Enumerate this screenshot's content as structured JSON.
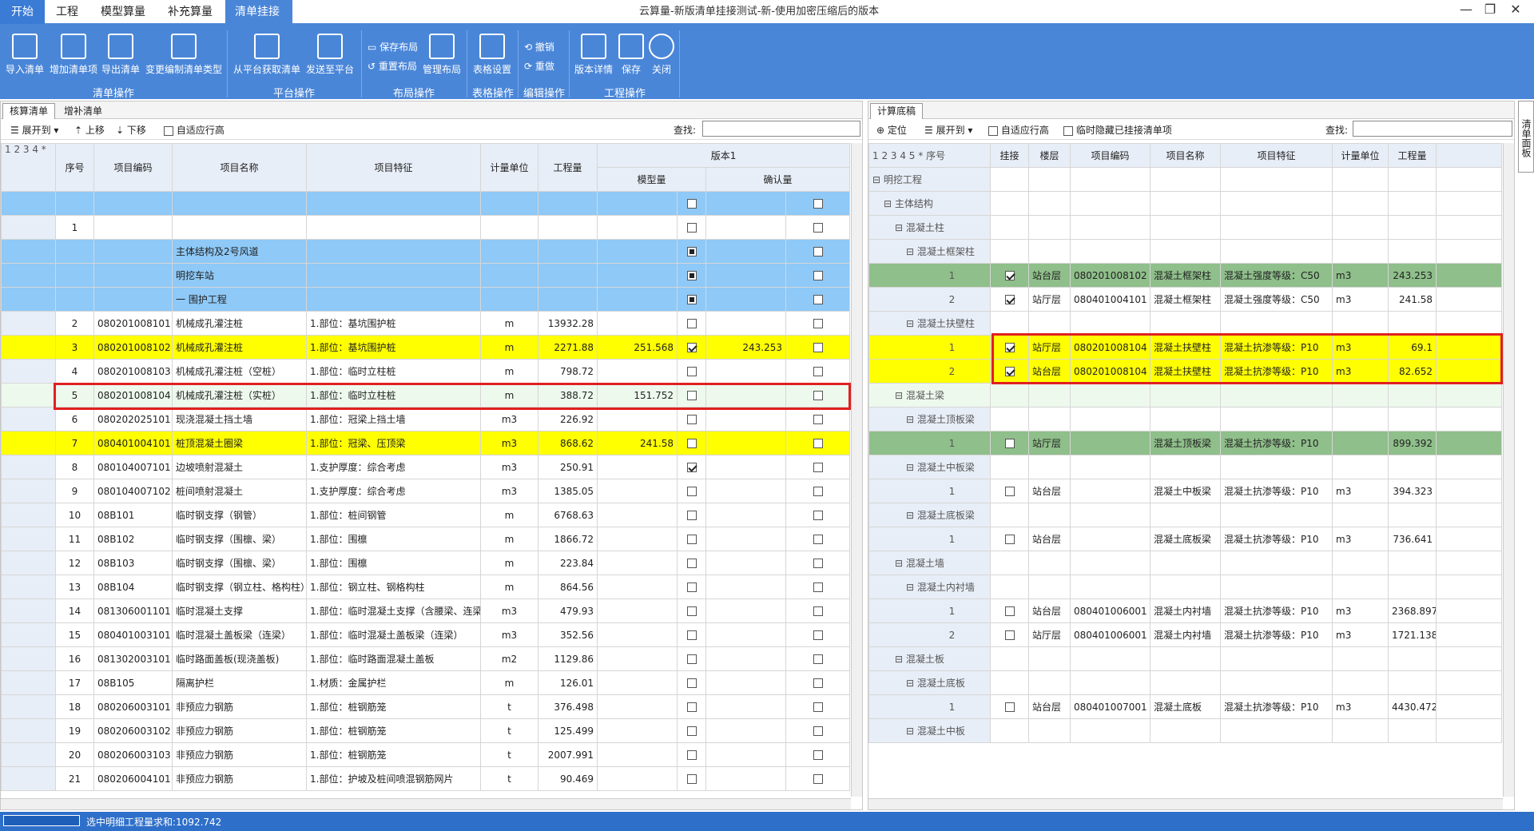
{
  "menu_tabs": [
    "开始",
    "工程",
    "模型算量",
    "补充算量",
    "清单挂接"
  ],
  "window_title": "云算量-新版清单挂接测试-新-使用加密压缩后的版本",
  "window_controls": [
    "—",
    "❐",
    "✕"
  ],
  "ribbon": {
    "buttons": [
      "导入清单",
      "增加清单项",
      "导出清单",
      "变更编制清单类型",
      "从平台获取清单",
      "发送至平台",
      "管理布局",
      "表格设置",
      "版本详情",
      "保存",
      "关闭"
    ],
    "small": [
      "保存布局",
      "重置布局",
      "撤销",
      "重做"
    ],
    "groups": [
      "清单操作",
      "平台操作",
      "布局操作",
      "表格操作",
      "编辑操作",
      "工程操作"
    ]
  },
  "left": {
    "tabs": [
      "核算清单",
      "增补清单"
    ],
    "toolbar": {
      "levels": "1 2 3 4 *",
      "expand": "展开到",
      "up": "上移",
      "down": "下移",
      "auto": "自适应行高",
      "search": "查找:"
    },
    "headers": {
      "seq": "序号",
      "code": "项目编码",
      "name": "项目名称",
      "feature": "项目特征",
      "unit": "计量单位",
      "qty": "工程量",
      "version": "版本1",
      "model": "模型量",
      "confirm": "确认量"
    },
    "rows": [
      {
        "seq": "",
        "code": "",
        "name": "",
        "feature": "",
        "unit": "",
        "qty": "",
        "model": "",
        "mc": "off",
        "confirm": "",
        "cc": "off",
        "style": "blue"
      },
      {
        "seq": "1",
        "code": "",
        "name": "",
        "feature": "",
        "unit": "",
        "qty": "",
        "model": "",
        "mc": "off",
        "confirm": "",
        "cc": "off",
        "style": ""
      },
      {
        "seq": "",
        "code": "",
        "name": "主体结构及2号风道",
        "feature": "",
        "unit": "",
        "qty": "",
        "model": "",
        "mc": "sq",
        "confirm": "",
        "cc": "off",
        "style": "blue"
      },
      {
        "seq": "",
        "code": "",
        "name": "明挖车站",
        "feature": "",
        "unit": "",
        "qty": "",
        "model": "",
        "mc": "sq",
        "confirm": "",
        "cc": "off",
        "style": "blue"
      },
      {
        "seq": "",
        "code": "",
        "name": "一 围护工程",
        "feature": "",
        "unit": "",
        "qty": "",
        "model": "",
        "mc": "sq",
        "confirm": "",
        "cc": "off",
        "style": "blue"
      },
      {
        "seq": "2",
        "code": "080201008101",
        "name": "机械成孔灌注桩",
        "feature": "1.部位：基坑围护桩",
        "unit": "m",
        "qty": "13932.28",
        "model": "",
        "mc": "off",
        "confirm": "",
        "cc": "off",
        "style": ""
      },
      {
        "seq": "3",
        "code": "080201008102",
        "name": "机械成孔灌注桩",
        "feature": "1.部位：基坑围护桩",
        "unit": "m",
        "qty": "2271.88",
        "model": "251.568",
        "mc": "on",
        "confirm": "243.253",
        "cc": "off",
        "style": "yellow"
      },
      {
        "seq": "4",
        "code": "080201008103",
        "name": "机械成孔灌注桩（空桩）",
        "feature": "1.部位：临时立柱桩",
        "unit": "m",
        "qty": "798.72",
        "model": "",
        "mc": "off",
        "confirm": "",
        "cc": "off",
        "style": ""
      },
      {
        "seq": "5",
        "code": "080201008104",
        "name": "机械成孔灌注桩（实桩）",
        "feature": "1.部位：临时立柱桩",
        "unit": "m",
        "qty": "388.72",
        "model": "151.752",
        "mc": "off",
        "confirm": "",
        "cc": "off",
        "style": "lgreen"
      },
      {
        "seq": "6",
        "code": "080202025101",
        "name": "现浇混凝土挡土墙",
        "feature": "1.部位：冠梁上挡土墙",
        "unit": "m3",
        "qty": "226.92",
        "model": "",
        "mc": "off",
        "confirm": "",
        "cc": "off",
        "style": ""
      },
      {
        "seq": "7",
        "code": "080401004101",
        "name": "桩顶混凝土圈梁",
        "feature": "1.部位：冠梁、压顶梁",
        "unit": "m3",
        "qty": "868.62",
        "model": "241.58",
        "mc": "off",
        "confirm": "",
        "cc": "off",
        "style": "yellow"
      },
      {
        "seq": "8",
        "code": "080104007101",
        "name": "边坡喷射混凝土",
        "feature": "1.支护厚度：综合考虑",
        "unit": "m3",
        "qty": "250.91",
        "model": "",
        "mc": "on",
        "confirm": "",
        "cc": "off",
        "style": ""
      },
      {
        "seq": "9",
        "code": "080104007102",
        "name": "桩间喷射混凝土",
        "feature": "1.支护厚度：综合考虑",
        "unit": "m3",
        "qty": "1385.05",
        "model": "",
        "mc": "off",
        "confirm": "",
        "cc": "off",
        "style": ""
      },
      {
        "seq": "10",
        "code": "08B101",
        "name": "临时钢支撑（钢管）",
        "feature": "1.部位：桩间钢管",
        "unit": "m",
        "qty": "6768.63",
        "model": "",
        "mc": "off",
        "confirm": "",
        "cc": "off",
        "style": ""
      },
      {
        "seq": "11",
        "code": "08B102",
        "name": "临时钢支撑（围檩、梁）",
        "feature": "1.部位：围檩",
        "unit": "m",
        "qty": "1866.72",
        "model": "",
        "mc": "off",
        "confirm": "",
        "cc": "off",
        "style": ""
      },
      {
        "seq": "12",
        "code": "08B103",
        "name": "临时钢支撑（围檩、梁）",
        "feature": "1.部位：围檩",
        "unit": "m",
        "qty": "223.84",
        "model": "",
        "mc": "off",
        "confirm": "",
        "cc": "off",
        "style": ""
      },
      {
        "seq": "13",
        "code": "08B104",
        "name": "临时钢支撑（钢立柱、格构柱）",
        "feature": "1.部位：钢立柱、钢格构柱",
        "unit": "m",
        "qty": "864.56",
        "model": "",
        "mc": "off",
        "confirm": "",
        "cc": "off",
        "style": ""
      },
      {
        "seq": "14",
        "code": "081306001101",
        "name": "临时混凝土支撑",
        "feature": "1.部位：临时混凝土支撑（含腰梁、连梁",
        "unit": "m3",
        "qty": "479.93",
        "model": "",
        "mc": "off",
        "confirm": "",
        "cc": "off",
        "style": ""
      },
      {
        "seq": "15",
        "code": "080401003101",
        "name": "临时混凝土盖板梁（连梁）",
        "feature": "1.部位：临时混凝土盖板梁（连梁）",
        "unit": "m3",
        "qty": "352.56",
        "model": "",
        "mc": "off",
        "confirm": "",
        "cc": "off",
        "style": ""
      },
      {
        "seq": "16",
        "code": "081302003101",
        "name": "临时路面盖板(现浇盖板)",
        "feature": "1.部位：临时路面混凝土盖板",
        "unit": "m2",
        "qty": "1129.86",
        "model": "",
        "mc": "off",
        "confirm": "",
        "cc": "off",
        "style": ""
      },
      {
        "seq": "17",
        "code": "08B105",
        "name": "隔离护栏",
        "feature": "1.材质：金属护栏",
        "unit": "m",
        "qty": "126.01",
        "model": "",
        "mc": "off",
        "confirm": "",
        "cc": "off",
        "style": ""
      },
      {
        "seq": "18",
        "code": "080206003101",
        "name": "非预应力钢筋",
        "feature": "1.部位：桩钢筋笼",
        "unit": "t",
        "qty": "376.498",
        "model": "",
        "mc": "off",
        "confirm": "",
        "cc": "off",
        "style": ""
      },
      {
        "seq": "19",
        "code": "080206003102",
        "name": "非预应力钢筋",
        "feature": "1.部位：桩钢筋笼",
        "unit": "t",
        "qty": "125.499",
        "model": "",
        "mc": "off",
        "confirm": "",
        "cc": "off",
        "style": ""
      },
      {
        "seq": "20",
        "code": "080206003103",
        "name": "非预应力钢筋",
        "feature": "1.部位：桩钢筋笼",
        "unit": "t",
        "qty": "2007.991",
        "model": "",
        "mc": "off",
        "confirm": "",
        "cc": "off",
        "style": ""
      },
      {
        "seq": "21",
        "code": "080206004101",
        "name": "非预应力钢筋",
        "feature": "1.部位：护坡及桩间喷混钢筋网片",
        "unit": "t",
        "qty": "90.469",
        "model": "",
        "mc": "off",
        "confirm": "",
        "cc": "off",
        "style": ""
      }
    ]
  },
  "right": {
    "tabs": [
      "计算底稿"
    ],
    "toolbar": {
      "locate": "定位",
      "levels": "1 2 3 4 5 *",
      "expand": "展开到",
      "auto": "自适应行高",
      "hide": "临时隐藏已挂接清单项",
      "search": "查找:"
    },
    "headers": {
      "seq": "序号",
      "hook": "挂接",
      "floor": "楼层",
      "code": "项目编码",
      "name": "项目名称",
      "feature": "项目特征",
      "unit": "计量单位",
      "qty": "工程量"
    },
    "rows": [
      {
        "label": "明挖工程",
        "indent": 0,
        "cb": "",
        "floor": "",
        "code": "",
        "name": "",
        "feature": "",
        "unit": "",
        "qty": "",
        "style": ""
      },
      {
        "label": "主体结构",
        "indent": 1,
        "cb": "",
        "floor": "",
        "code": "",
        "name": "",
        "feature": "",
        "unit": "",
        "qty": "",
        "style": ""
      },
      {
        "label": "混凝土柱",
        "indent": 2,
        "cb": "",
        "floor": "",
        "code": "",
        "name": "",
        "feature": "",
        "unit": "",
        "qty": "",
        "style": ""
      },
      {
        "label": "混凝土框架柱",
        "indent": 3,
        "cb": "",
        "floor": "",
        "code": "",
        "name": "",
        "feature": "",
        "unit": "",
        "qty": "",
        "style": ""
      },
      {
        "label": "1",
        "indent": 4,
        "cb": "on",
        "floor": "站台层",
        "code": "080201008102",
        "name": "混凝土框架柱",
        "feature": "混凝土强度等级：C50",
        "unit": "m3",
        "qty": "243.253",
        "style": "green"
      },
      {
        "label": "2",
        "indent": 4,
        "cb": "on",
        "floor": "站厅层",
        "code": "080401004101",
        "name": "混凝土框架柱",
        "feature": "混凝土强度等级：C50",
        "unit": "m3",
        "qty": "241.58",
        "style": ""
      },
      {
        "label": "混凝土扶壁柱",
        "indent": 3,
        "cb": "",
        "floor": "",
        "code": "",
        "name": "",
        "feature": "",
        "unit": "",
        "qty": "",
        "style": ""
      },
      {
        "label": "1",
        "indent": 4,
        "cb": "on",
        "floor": "站厅层",
        "code": "080201008104",
        "name": "混凝土扶壁柱",
        "feature": "混凝土抗渗等级：P10",
        "unit": "m3",
        "qty": "69.1",
        "style": "yellow"
      },
      {
        "label": "2",
        "indent": 4,
        "cb": "on",
        "floor": "站台层",
        "code": "080201008104",
        "name": "混凝土扶壁柱",
        "feature": "混凝土抗渗等级：P10",
        "unit": "m3",
        "qty": "82.652",
        "style": "yellow"
      },
      {
        "label": "混凝土梁",
        "indent": 2,
        "cb": "",
        "floor": "",
        "code": "",
        "name": "",
        "feature": "",
        "unit": "",
        "qty": "",
        "style": "lgreen"
      },
      {
        "label": "混凝土顶板梁",
        "indent": 3,
        "cb": "",
        "floor": "",
        "code": "",
        "name": "",
        "feature": "",
        "unit": "",
        "qty": "",
        "style": ""
      },
      {
        "label": "1",
        "indent": 4,
        "cb": "off",
        "floor": "站厅层",
        "code": "",
        "name": "混凝土顶板梁",
        "feature": "混凝土抗渗等级：P10",
        "unit": "",
        "qty": "899.392",
        "style": "green"
      },
      {
        "label": "混凝土中板梁",
        "indent": 3,
        "cb": "",
        "floor": "",
        "code": "",
        "name": "",
        "feature": "",
        "unit": "",
        "qty": "",
        "style": ""
      },
      {
        "label": "1",
        "indent": 4,
        "cb": "off",
        "floor": "站台层",
        "code": "",
        "name": "混凝土中板梁",
        "feature": "混凝土抗渗等级：P10",
        "unit": "m3",
        "qty": "394.323",
        "style": ""
      },
      {
        "label": "混凝土底板梁",
        "indent": 3,
        "cb": "",
        "floor": "",
        "code": "",
        "name": "",
        "feature": "",
        "unit": "",
        "qty": "",
        "style": ""
      },
      {
        "label": "1",
        "indent": 4,
        "cb": "off",
        "floor": "站台层",
        "code": "",
        "name": "混凝土底板梁",
        "feature": "混凝土抗渗等级：P10",
        "unit": "m3",
        "qty": "736.641",
        "style": ""
      },
      {
        "label": "混凝土墙",
        "indent": 2,
        "cb": "",
        "floor": "",
        "code": "",
        "name": "",
        "feature": "",
        "unit": "",
        "qty": "",
        "style": ""
      },
      {
        "label": "混凝土内衬墙",
        "indent": 3,
        "cb": "",
        "floor": "",
        "code": "",
        "name": "",
        "feature": "",
        "unit": "",
        "qty": "",
        "style": ""
      },
      {
        "label": "1",
        "indent": 4,
        "cb": "off",
        "floor": "站台层",
        "code": "080401006001",
        "name": "混凝土内衬墙",
        "feature": "混凝土抗渗等级：P10",
        "unit": "m3",
        "qty": "2368.897",
        "style": ""
      },
      {
        "label": "2",
        "indent": 4,
        "cb": "off",
        "floor": "站厅层",
        "code": "080401006001",
        "name": "混凝土内衬墙",
        "feature": "混凝土抗渗等级：P10",
        "unit": "m3",
        "qty": "1721.138",
        "style": ""
      },
      {
        "label": "混凝土板",
        "indent": 2,
        "cb": "",
        "floor": "",
        "code": "",
        "name": "",
        "feature": "",
        "unit": "",
        "qty": "",
        "style": ""
      },
      {
        "label": "混凝土底板",
        "indent": 3,
        "cb": "",
        "floor": "",
        "code": "",
        "name": "",
        "feature": "",
        "unit": "",
        "qty": "",
        "style": ""
      },
      {
        "label": "1",
        "indent": 4,
        "cb": "off",
        "floor": "站台层",
        "code": "080401007001",
        "name": "混凝土底板",
        "feature": "混凝土抗渗等级：P10",
        "unit": "m3",
        "qty": "4430.472",
        "style": ""
      },
      {
        "label": "混凝土中板",
        "indent": 3,
        "cb": "",
        "floor": "",
        "code": "",
        "name": "",
        "feature": "",
        "unit": "",
        "qty": "",
        "style": ""
      }
    ]
  },
  "side_panel": "清单面板",
  "status": "选中明细工程量求和:1092.742"
}
